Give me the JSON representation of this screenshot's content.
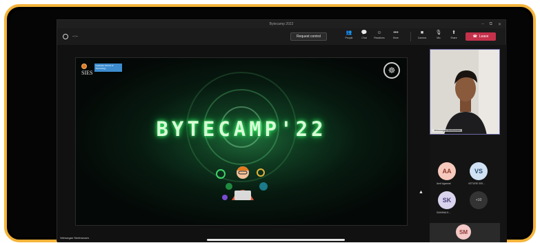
{
  "window": {
    "title": "Bytecamp 2022"
  },
  "window_controls": {
    "minimize": "–",
    "restore": "⧉",
    "close": "✕"
  },
  "meeting": {
    "timer": "--:--"
  },
  "toolbar": {
    "request_control": "Request control",
    "items": [
      {
        "icon": "people-icon",
        "glyph": "👥",
        "label": "People"
      },
      {
        "icon": "chat-icon",
        "glyph": "💬",
        "label": "Chat"
      },
      {
        "icon": "reactions-icon",
        "glyph": "☺",
        "label": "Reactions"
      },
      {
        "icon": "more-icon",
        "glyph": "•••",
        "label": "More"
      },
      {
        "icon": "camera-icon",
        "glyph": "■",
        "label": "Camera"
      },
      {
        "icon": "mic-icon",
        "glyph": "🎙",
        "label": "Mic"
      },
      {
        "icon": "share-icon",
        "glyph": "⬆",
        "label": "Share"
      }
    ],
    "leave": "Leave",
    "leave_color": "#c4314b"
  },
  "slide": {
    "title": "BYTECAMP'22",
    "logo_text": "SIES",
    "logo_tagline": "Graduate School of Technology",
    "emblem": "☸"
  },
  "presenter_label": "Velmurgan Senthurvam",
  "self_view": {
    "name": "Velmurugan Senthurvam"
  },
  "participants": [
    {
      "initials": "AA",
      "label": "Amit Agarwal",
      "bg": "#f6c9bd",
      "fg": "#8a3b2a"
    },
    {
      "initials": "VS",
      "label": "VETURE SRI...",
      "bg": "#cfe1f3",
      "fg": "#2c4e74"
    },
    {
      "initials": "SK",
      "label": "SAHANA K...",
      "bg": "#d9d3ee",
      "fg": "#4b3f78"
    },
    {
      "initials": "SM",
      "label": "",
      "bg": "#f4c9c7",
      "fg": "#8c3a36"
    }
  ],
  "more_participants": "+10",
  "accent": "#f4b43a"
}
